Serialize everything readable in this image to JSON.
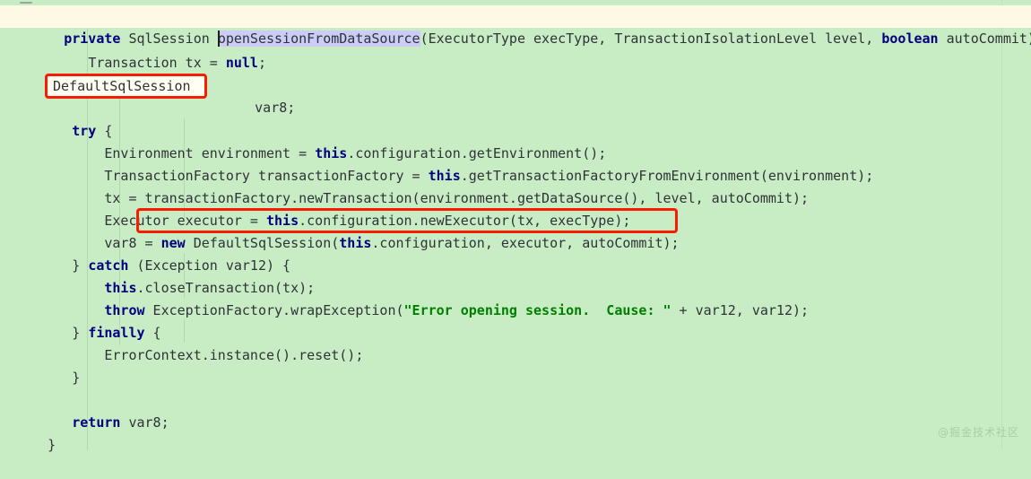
{
  "editor": {
    "language": "java",
    "colors": {
      "background": "#c8ecc4",
      "current_line_background": "#fdf9e4",
      "selection": "#ccccf7",
      "keyword": "#000080",
      "string": "#008000",
      "text": "#2f3337",
      "annotation_box": "#f91c00",
      "indent_guide": "#b3d8b0"
    },
    "gutter_icon": "hamburger-fold-icon",
    "caret_line": 1
  },
  "code": {
    "line1": {
      "kw_private": "private",
      "type": "SqlSession",
      "method_selected": "openSessionFromDataSource",
      "params": "(ExecutorType execType, TransactionIsolationLevel level, ",
      "kw_boolean": "boolean",
      "params_tail": " autoCommit) {"
    },
    "line2": {
      "pre": "Transaction tx = ",
      "kw": "null",
      "post": ";"
    },
    "line4_boxed": "DefaultSqlSession",
    "line4_rest": " var8;",
    "line5": {
      "kw": "try",
      "rest": " {"
    },
    "line6": {
      "pre": "Environment environment = ",
      "kw": "this",
      "post": ".configuration.getEnvironment();"
    },
    "line7": {
      "pre": "TransactionFactory transactionFactory = ",
      "kw": "this",
      "post": ".getTransactionFactoryFromEnvironment(environment);"
    },
    "line8": "tx = transactionFactory.newTransaction(environment.getDataSource(), level, autoCommit);",
    "line9": {
      "pre": "Executor executor = ",
      "kw": "this",
      "post": ".configuration.newExecutor(tx, execType);"
    },
    "line10": {
      "pre": "var8 = ",
      "kw": "new",
      "mid": " DefaultSqlSession(",
      "kw2": "this",
      "post": ".configuration, executor, autoCommit);"
    },
    "line11": {
      "pre": "} ",
      "kw": "catch",
      "post": " (Exception var12) {"
    },
    "line12": {
      "kw": "this",
      "post": ".closeTransaction(tx);"
    },
    "line13": {
      "kw": "throw",
      "mid": " ExceptionFactory.wrapException(",
      "str": "\"Error opening session.  Cause: \"",
      "post": " + var12, var12);"
    },
    "line14": {
      "pre": "} ",
      "kw": "finally",
      "post": " {"
    },
    "line15": "ErrorContext.instance().reset();",
    "line16": "}",
    "line18": {
      "kw": "return",
      "post": " var8;"
    },
    "line19": "}"
  },
  "annotations": {
    "box1_target": "DefaultSqlSession",
    "box2_target": "new DefaultSqlSession(this.configuration, executor, autoCommit);"
  },
  "watermark": {
    "text": "@掘金技术社区"
  }
}
